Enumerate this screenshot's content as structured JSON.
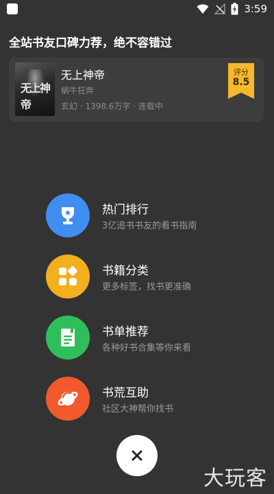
{
  "status_bar": {
    "time": "3:59",
    "icons": [
      "app-notification-icon",
      "wifi-icon",
      "no-signal-icon",
      "battery-charging-icon"
    ]
  },
  "recommend": {
    "heading": "全站书友口碑力荐，绝不容错过",
    "book": {
      "title": "无上神帝",
      "author": "蜗牛狂奔",
      "meta": "玄幻 · 1398.6万字 · 连载中",
      "score_label": "评分",
      "score_value": "8.5",
      "cover_text": "无上神帝"
    }
  },
  "menu": [
    {
      "title": "热门排行",
      "subtitle": "3亿追书书友的看书指南",
      "icon": "trophy-icon",
      "color": "#3f8ef0"
    },
    {
      "title": "书籍分类",
      "subtitle": "更多标签，找书更准确",
      "icon": "category-grid-icon",
      "color": "#f2b01e"
    },
    {
      "title": "书单推荐",
      "subtitle": "各种好书合集等你来看",
      "icon": "booklist-icon",
      "color": "#2fbf5a"
    },
    {
      "title": "书荒互助",
      "subtitle": "社区大神帮你找书",
      "icon": "planet-icon",
      "color": "#f25a2e"
    }
  ],
  "colors": {
    "background": "#333333",
    "card": "#3d3d3d",
    "score_badge": "#f5b82e"
  },
  "close_icon": "close-icon",
  "watermark": "大玩客"
}
